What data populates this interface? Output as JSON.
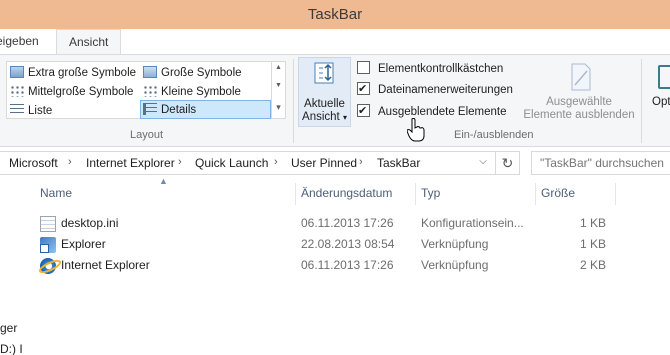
{
  "window": {
    "title": "TaskBar"
  },
  "tabs": [
    {
      "label": "eigeben"
    },
    {
      "label": "Ansicht"
    }
  ],
  "ribbon": {
    "layout": {
      "items": [
        {
          "label": "Extra große Symbole",
          "icon": "extra-large-icons-icon"
        },
        {
          "label": "Große Symbole",
          "icon": "large-icons-icon"
        },
        {
          "label": "Mittelgroße Symbole",
          "icon": "medium-icons-icon"
        },
        {
          "label": "Kleine Symbole",
          "icon": "small-icons-icon"
        },
        {
          "label": "Liste",
          "icon": "list-icon"
        },
        {
          "label": "Details",
          "icon": "details-icon",
          "selected": true
        }
      ],
      "group_label": "Layout"
    },
    "current_view": {
      "line1": "Aktuelle",
      "line2": "Ansicht"
    },
    "show_hide": {
      "checkboxes": [
        {
          "label": "Elementkontrollkästchen",
          "checked": false
        },
        {
          "label": "Dateinamenerweiterungen",
          "checked": true
        },
        {
          "label": "Ausgeblendete Elemente",
          "checked": true
        }
      ],
      "hide_selected": {
        "line1": "Ausgewählte",
        "line2": "Elemente ausblenden"
      },
      "group_label": "Ein-/ausblenden"
    },
    "options": {
      "label": "Opt"
    }
  },
  "address": {
    "crumbs": [
      "Microsoft",
      "Internet Explorer",
      "Quick Launch",
      "User Pinned",
      "TaskBar"
    ],
    "search_placeholder": "\"TaskBar\" durchsuchen"
  },
  "nav_fragment": [
    "ger",
    "D:) I"
  ],
  "columns": {
    "name": "Name",
    "date": "Änderungsdatum",
    "type": "Typ",
    "size": "Größe"
  },
  "files": [
    {
      "name": "desktop.ini",
      "date": "06.11.2013 17:26",
      "type": "Konfigurationsein...",
      "size": "1 KB",
      "icon": "ini-file-icon"
    },
    {
      "name": "Explorer",
      "date": "22.08.2013 08:54",
      "type": "Verknüpfung",
      "size": "1 KB",
      "icon": "shortcut-icon"
    },
    {
      "name": "Internet Explorer",
      "date": "06.11.2013 17:26",
      "type": "Verknüpfung",
      "size": "2 KB",
      "icon": "ie-shortcut-icon"
    }
  ],
  "colors": {
    "titlebar": "#efb992",
    "ribbon_bg": "#f5f6f7",
    "selection": "#cde8fb"
  }
}
